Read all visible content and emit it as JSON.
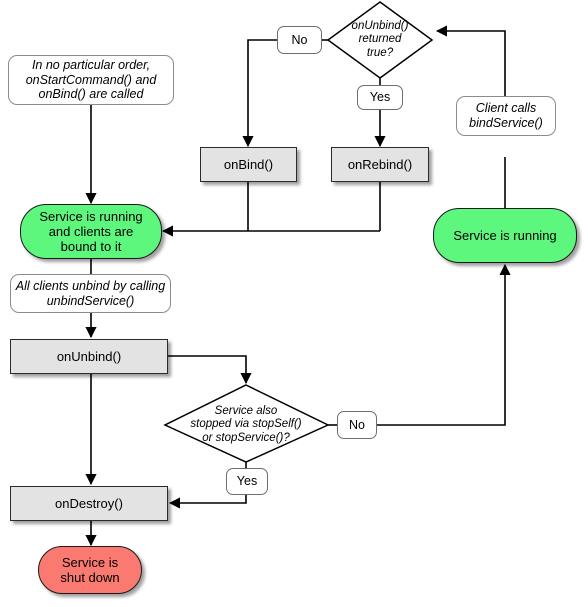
{
  "diagram": {
    "title": "Android Service lifecycle (bound service) flowchart",
    "colors": {
      "running_state": "#5df77e",
      "shutdown_state": "#fa7a72",
      "process_box": "#e3e3e3",
      "note_box": "#ffffff",
      "stroke": "#000000",
      "background": "#ffffff"
    },
    "nodes": {
      "note_start": {
        "type": "note",
        "text": "In no particular order,\nonStartCommand() and\nonBind() are called"
      },
      "decision_unbind_returned_true": {
        "type": "decision",
        "text": "onUnbind()\nreturned\ntrue?"
      },
      "label_no_top": {
        "type": "branch-label",
        "text": "No"
      },
      "label_yes_top": {
        "type": "branch-label",
        "text": "Yes"
      },
      "on_bind": {
        "type": "process",
        "text": "onBind()"
      },
      "on_rebind": {
        "type": "process",
        "text": "onRebind()"
      },
      "note_client_binds": {
        "type": "note",
        "text": "Client calls\nbindService()"
      },
      "state_running_bound": {
        "type": "state",
        "text": "Service is running\nand clients are\nbound to it"
      },
      "state_running": {
        "type": "state",
        "text": "Service is running"
      },
      "note_all_unbind": {
        "type": "note",
        "text": "All clients unbind by calling\nunbindService()"
      },
      "on_unbind": {
        "type": "process",
        "text": "onUnbind()"
      },
      "decision_stopped_via_stopself": {
        "type": "decision",
        "text": "Service also\nstopped via stopSelf()\nor stopService()?"
      },
      "label_no_bottom": {
        "type": "branch-label",
        "text": "No"
      },
      "label_yes_bottom": {
        "type": "branch-label",
        "text": "Yes"
      },
      "on_destroy": {
        "type": "process",
        "text": "onDestroy()"
      },
      "state_shut_down": {
        "type": "state",
        "text": "Service is\nshut down"
      }
    }
  }
}
